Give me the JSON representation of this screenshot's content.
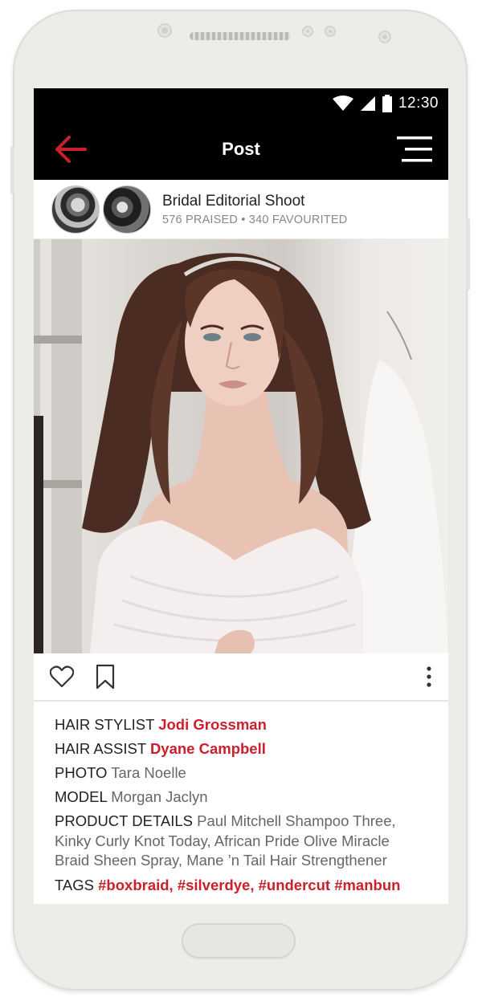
{
  "status_bar": {
    "time": "12:30"
  },
  "app_bar": {
    "title": "Post"
  },
  "post": {
    "title": "Bridal Editorial Shoot",
    "stats": "576 PRAISED • 340 FAVOURITED"
  },
  "details": {
    "hair_stylist": {
      "label": "HAIR STYLIST",
      "value": "Jodi Grossman"
    },
    "hair_assist": {
      "label": "HAIR ASSIST",
      "value": "Dyane Campbell"
    },
    "photo": {
      "label": "PHOTO",
      "value": "Tara Noelle"
    },
    "model": {
      "label": "MODEL",
      "value": "Morgan Jaclyn"
    },
    "product_details": {
      "label": "PRODUCT DETAILS",
      "value": "Paul Mitchell Shampoo Three, Kinky Curly Knot Today, African Pride Olive Miracle Braid Sheen Spray, Mane ’n Tail Hair Strengthener"
    },
    "tags": {
      "label": "TAGS",
      "value": "#boxbraid, #silverdye, #undercut #manbun"
    }
  },
  "colors": {
    "accent": "#cc1f2b",
    "bar": "#000000",
    "phone": "#ececE9"
  },
  "icons": [
    "back-arrow-icon",
    "menu-icon",
    "heart-icon",
    "bookmark-icon",
    "more-vertical-icon",
    "wifi-icon",
    "signal-icon",
    "battery-icon"
  ]
}
